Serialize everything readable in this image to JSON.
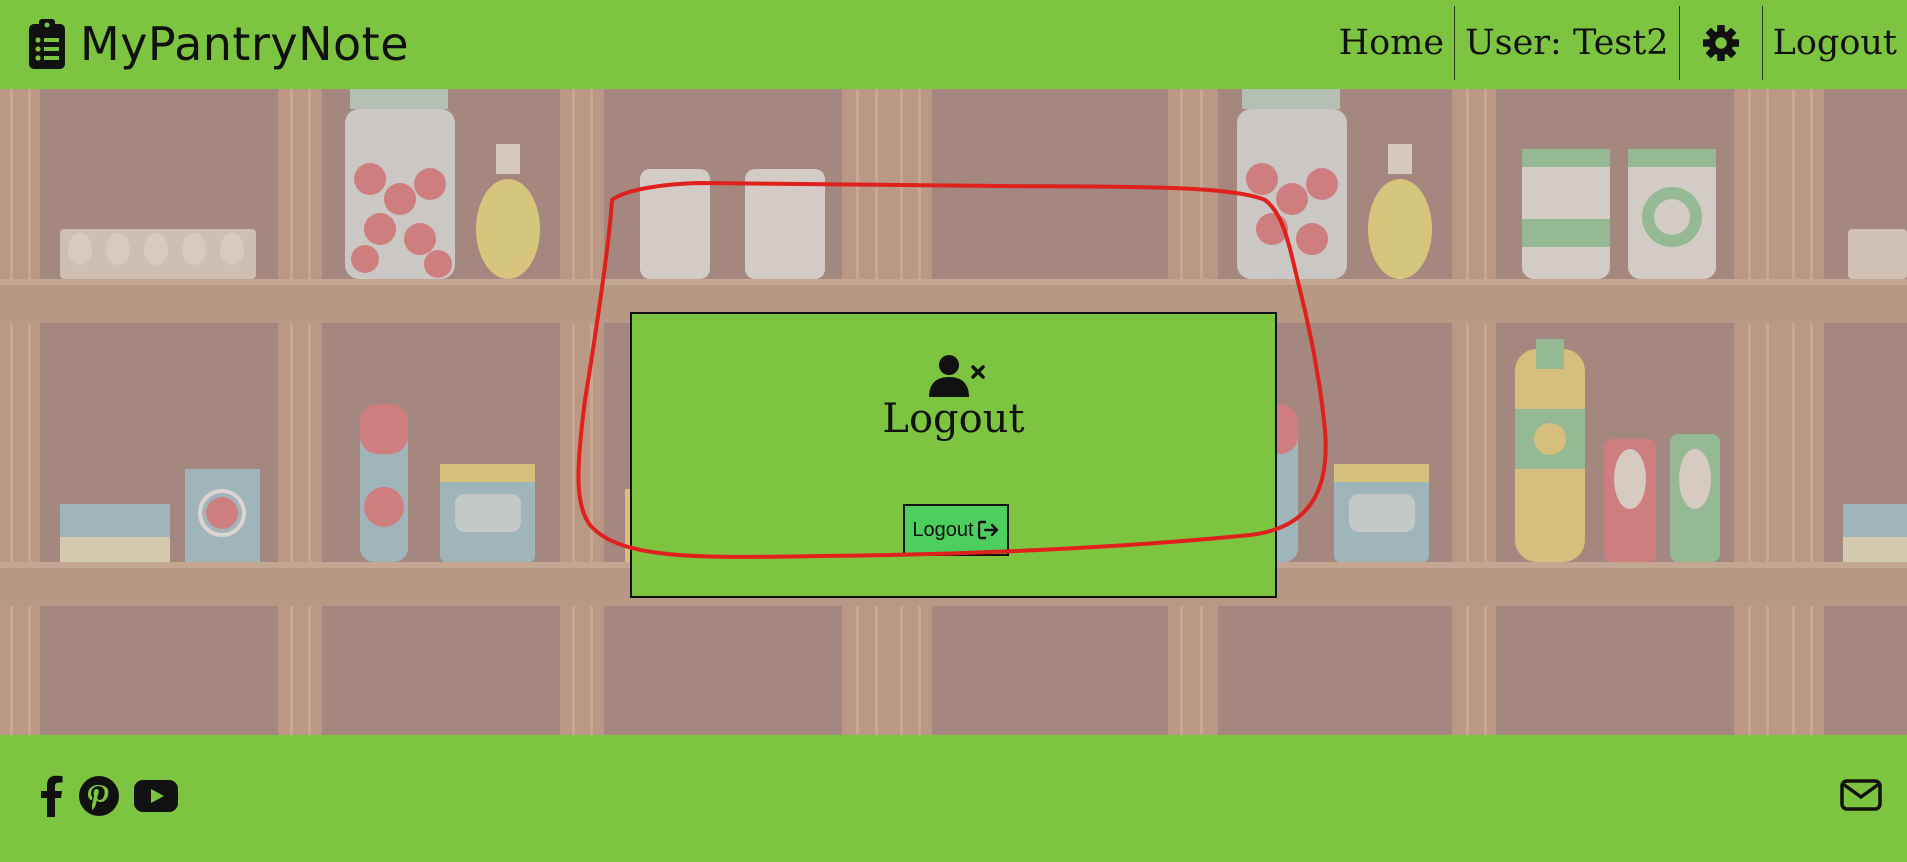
{
  "header": {
    "brand": "MyPantryNote",
    "nav": {
      "home": "Home",
      "user": "User: Test2",
      "logout": "Logout"
    }
  },
  "modal": {
    "title": "Logout",
    "button_label": "Logout"
  },
  "icons": {
    "brand": "clipboard-icon",
    "settings": "gear-icon",
    "modal": "user-times-icon",
    "button": "sign-out-icon",
    "footer_left": [
      "facebook-icon",
      "pinterest-icon",
      "youtube-icon"
    ],
    "footer_right": "envelope-icon"
  },
  "colors": {
    "primary": "#7dc540",
    "button": "#4ccf5c",
    "annotation": "#e0201c",
    "background_overlay": "#a5877e"
  }
}
